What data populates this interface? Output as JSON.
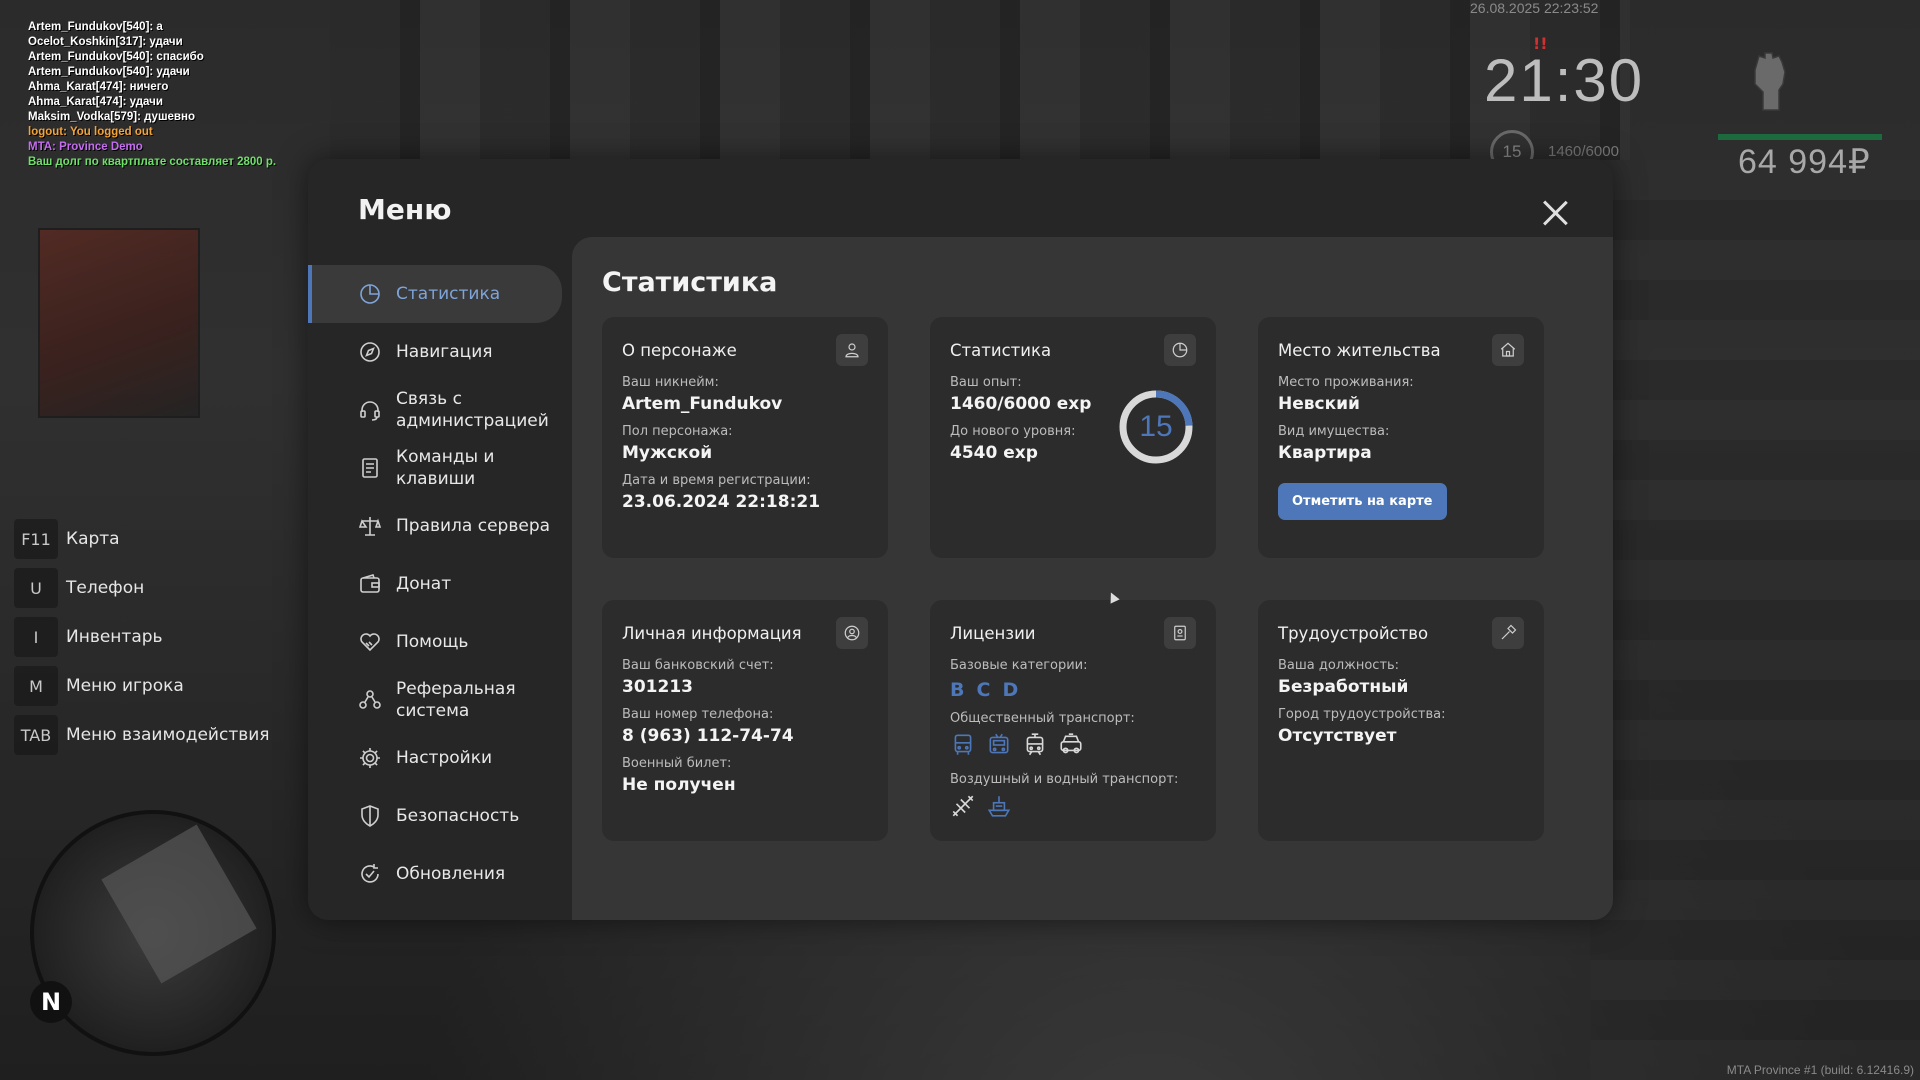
{
  "chat": [
    {
      "text": "Artem_Fundukov[540]: а",
      "color": "#ffffff"
    },
    {
      "text": "Ocelot_Koshkin[317]: удачи",
      "color": "#ffffff"
    },
    {
      "text": "Artem_Fundukov[540]: спасибо",
      "color": "#ffffff"
    },
    {
      "text": "Artem_Fundukov[540]: удачи",
      "color": "#ffffff"
    },
    {
      "text": "Ahma_Karat[474]: ничего",
      "color": "#ffffff"
    },
    {
      "text": "Ahma_Karat[474]: удачи",
      "color": "#ffffff"
    },
    {
      "text": "Maksim_Vodka[579]: душевно",
      "color": "#ffffff"
    },
    {
      "text": "logout: You logged out",
      "color": "#f2a33a"
    },
    {
      "text": "MTA: Province Demo",
      "color": "#c56cf0"
    },
    {
      "text": "Ваш долг по квартплате составляет 2800 р.",
      "color": "#6fe06a"
    }
  ],
  "hud": {
    "datetime": "26.08.2025 22:23:52",
    "time": "21:30",
    "level": "15",
    "exp": "1460/6000",
    "money": "64 994₽",
    "health_color": "#1e6a3f"
  },
  "hotkeys": [
    {
      "key": "F11",
      "label": "Карта"
    },
    {
      "key": "U",
      "label": "Телефон"
    },
    {
      "key": "I",
      "label": "Инвентарь"
    },
    {
      "key": "M",
      "label": "Меню игрока"
    },
    {
      "key": "TAB",
      "label": "Меню взаимодействия"
    }
  ],
  "minimap": {
    "north": "N"
  },
  "build_info": "MTA Province #1 (build: 6.12416.9)",
  "menu": {
    "title": "Меню",
    "accent": "#4d77b8",
    "nav": [
      {
        "label": "Статистика",
        "icon": "pie-chart-icon",
        "active": true
      },
      {
        "label": "Навигация",
        "icon": "compass-icon",
        "active": false
      },
      {
        "label": "Связь с администрацией",
        "icon": "headset-icon",
        "active": false
      },
      {
        "label": "Команды и клавиши",
        "icon": "document-list-icon",
        "active": false
      },
      {
        "label": "Правила сервера",
        "icon": "scales-icon",
        "active": false
      },
      {
        "label": "Донат",
        "icon": "wallet-icon",
        "active": false
      },
      {
        "label": "Помощь",
        "icon": "handshake-heart-icon",
        "active": false
      },
      {
        "label": "Реферальная система",
        "icon": "people-network-icon",
        "active": false
      },
      {
        "label": "Настройки",
        "icon": "gear-icon",
        "active": false
      },
      {
        "label": "Безопасность",
        "icon": "shield-icon",
        "active": false
      },
      {
        "label": "Обновления",
        "icon": "refresh-check-icon",
        "active": false
      }
    ]
  },
  "stats": {
    "title": "Статистика",
    "character": {
      "title": "О персонаже",
      "nick_label": "Ваш никнейм:",
      "nick": "Artem_Fundukov",
      "gender_label": "Пол персонажа:",
      "gender": "Мужской",
      "reg_label": "Дата и время регистрации:",
      "reg": "23.06.2024 22:18:21"
    },
    "statistics": {
      "title": "Статистика",
      "exp_label": "Ваш опыт:",
      "exp": "1460/6000 exp",
      "next_label": "До нового уровня:",
      "next": "4540 exp",
      "level": "15",
      "progress": 0.243
    },
    "residence": {
      "title": "Место жительства",
      "place_label": "Место проживания:",
      "place": "Невский",
      "type_label": "Вид имущества:",
      "type": "Квартира",
      "button": "Отметить на карте"
    },
    "personal": {
      "title": "Личная информация",
      "bank_label": "Ваш банковский счет:",
      "bank": "301213",
      "phone_label": "Ваш номер телефона:",
      "phone": "8 (963) 112-74-74",
      "military_label": "Военный билет:",
      "military": "Не получен"
    },
    "licenses": {
      "title": "Лицензии",
      "base_label": "Базовые категории:",
      "base": [
        "B",
        "C",
        "D"
      ],
      "public_label": "Общественный транспорт:",
      "public_icons": [
        "bus-icon",
        "trolleybus-icon",
        "tram-icon",
        "taxi-icon"
      ],
      "public_owned": [
        true,
        true,
        false,
        false
      ],
      "air_label": "Воздушный и водный транспорт:",
      "air_icons": [
        "airplane-icon",
        "boat-icon"
      ],
      "air_owned": [
        false,
        true
      ]
    },
    "employment": {
      "title": "Трудоустройство",
      "position_label": "Ваша должность:",
      "position": "Безработный",
      "city_label": "Город трудоустройства:",
      "city": "Отсутствует"
    }
  }
}
